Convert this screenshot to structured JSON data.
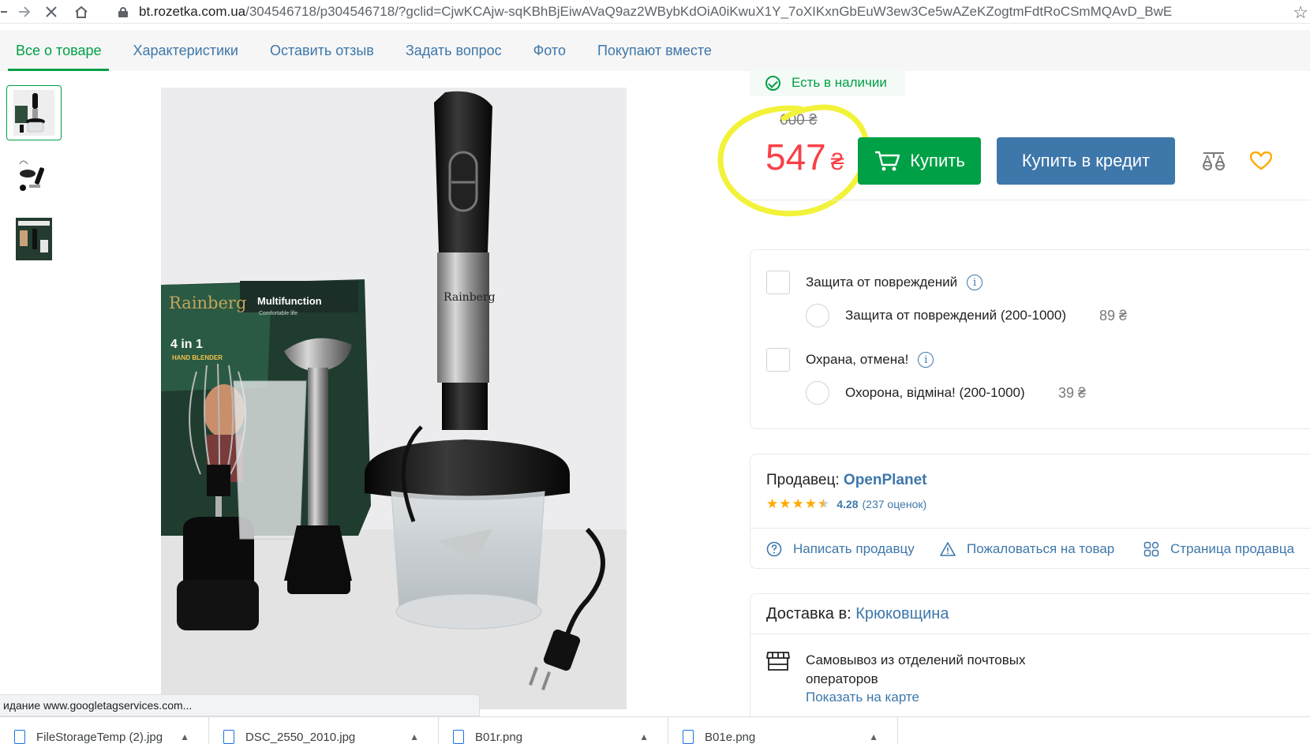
{
  "browser": {
    "url_domain": "bt.rozetka.com.ua",
    "url_rest": "/304546718/p304546718/?gclid=CjwKCAjw-sqKBhBjEiwAVaQ9az2WBybKdOiA0iKwuX1Y_7oXIKxnGbEuW3ew3Ce5wAZeKZogtmFdtRoCSmMQAvD_BwE"
  },
  "tabs": [
    {
      "label": "Все о товаре",
      "active": true
    },
    {
      "label": "Характеристики"
    },
    {
      "label": "Оставить отзыв"
    },
    {
      "label": "Задать вопрос"
    },
    {
      "label": "Фото"
    },
    {
      "label": "Покупают вместе"
    }
  ],
  "product": {
    "stock_label": "Есть в наличии",
    "old_price": "600 ₴",
    "price": "547",
    "currency": "₴",
    "buy_label": "Купить",
    "credit_label": "Купить в кредит",
    "photo_brand": "Rainberg",
    "box_text": "Multifunction",
    "box_subtext": "Comfortable life",
    "box_badge": "4 in 1",
    "box_badge2": "HAND BLENDER"
  },
  "services": {
    "group1_label": "Защита от повреждений",
    "group1_option": "Защита от повреждений (200-1000)",
    "group1_price": "89 ₴",
    "group2_label": "Охрана, отмена!",
    "group2_option": "Охорона, відміна! (200-1000)",
    "group2_price": "39 ₴",
    "info_glyph": "i"
  },
  "seller": {
    "prefix": "Продавец: ",
    "name": "OpenPlanet",
    "rating": "4.28",
    "reviews": "(237 оценок)",
    "rating_stars": 4.28,
    "links": {
      "write": "Написать продавцу",
      "complain": "Пожаловаться на товар",
      "page": "Страница продавца"
    }
  },
  "delivery": {
    "prefix": "Доставка в: ",
    "city": "Крюковщина",
    "option": "Самовывоз из отделений почтовых операторов",
    "show_map": "Показать на карте"
  },
  "status_bar": "идание www.googletagservices.com...",
  "downloads": [
    {
      "name": "FileStorageTemp (2).jpg"
    },
    {
      "name": "DSC_2550_2010.jpg"
    },
    {
      "name": "B01r.png"
    },
    {
      "name": "B01e.png"
    }
  ],
  "colors": {
    "accent_green": "#00a046",
    "link_blue": "#3e77aa",
    "price_red": "#f84147",
    "highlight_yellow": "#f2f23a",
    "star_orange": "#ffa900"
  }
}
